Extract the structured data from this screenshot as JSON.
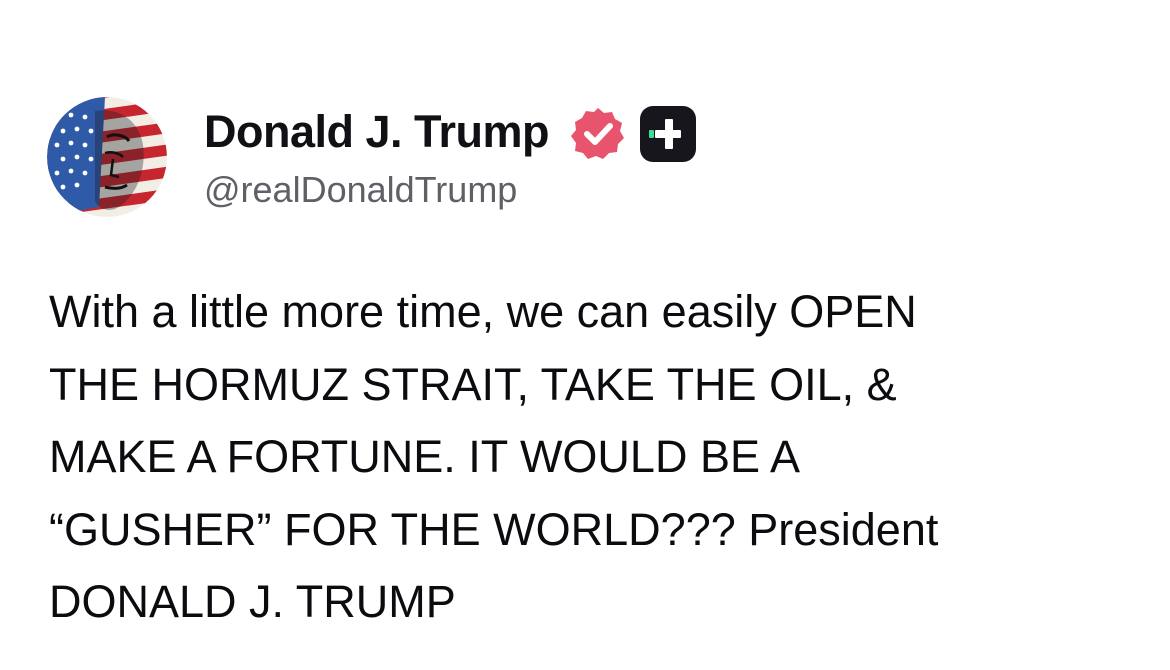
{
  "author": {
    "display_name": "Donald J. Trump",
    "handle": "@realDonaldTrump",
    "avatar_icon": "flag-portrait-avatar",
    "verified_icon": "verified-badge-icon",
    "verified_color": "#e8546d",
    "plus_icon": "plus-subscriber-icon",
    "plus_color": "#16161c"
  },
  "post": {
    "lines": [
      "With a little more time, we can easily OPEN",
      "THE HORMUZ STRAIT, TAKE THE OIL, &",
      "MAKE A FORTUNE. IT WOULD BE A",
      "“GUSHER” FOR THE WORLD??? President",
      "DONALD J. TRUMP"
    ]
  }
}
